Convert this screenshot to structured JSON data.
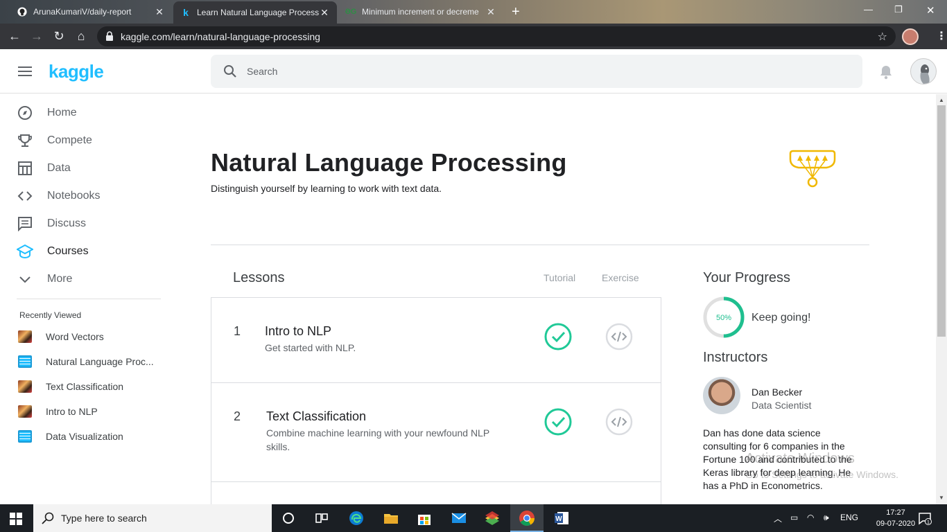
{
  "browser": {
    "tabs": [
      {
        "title": "ArunaKumariV/daily-report",
        "favicon": "github-icon"
      },
      {
        "title": "Learn Natural Language Processi",
        "favicon": "kaggle-icon"
      },
      {
        "title": "Minimum increment or decreme",
        "favicon": "gfg-icon"
      }
    ],
    "url": "kaggle.com/learn/natural-language-processing"
  },
  "header": {
    "logo": "kaggle",
    "search_placeholder": "Search"
  },
  "sidebar": {
    "items": [
      {
        "label": "Home",
        "icon": "compass-icon"
      },
      {
        "label": "Compete",
        "icon": "trophy-icon"
      },
      {
        "label": "Data",
        "icon": "table-icon"
      },
      {
        "label": "Notebooks",
        "icon": "code-icon"
      },
      {
        "label": "Discuss",
        "icon": "discuss-icon"
      },
      {
        "label": "Courses",
        "icon": "school-icon",
        "active": true
      },
      {
        "label": "More",
        "icon": "chevron-down-icon"
      }
    ],
    "recently_viewed_title": "Recently Viewed",
    "recently_viewed": [
      {
        "label": "Word Vectors",
        "icon": "course-thumbnail"
      },
      {
        "label": "Natural Language Proc...",
        "icon": "notebook-icon"
      },
      {
        "label": "Text Classification",
        "icon": "course-thumbnail"
      },
      {
        "label": "Intro to NLP",
        "icon": "course-thumbnail"
      },
      {
        "label": "Data Visualization",
        "icon": "notebook-icon"
      }
    ]
  },
  "course": {
    "title": "Natural Language Processing",
    "subtitle": "Distinguish yourself by learning to work with text data.",
    "lessons_heading": "Lessons",
    "col_tutorial": "Tutorial",
    "col_exercise": "Exercise",
    "lessons": [
      {
        "num": "1",
        "title": "Intro to NLP",
        "desc": "Get started with NLP.",
        "tutorial_done": true,
        "exercise_done": false
      },
      {
        "num": "2",
        "title": "Text Classification",
        "desc": "Combine machine learning with your newfound NLP skills.",
        "tutorial_done": true,
        "exercise_done": false
      }
    ]
  },
  "progress": {
    "heading": "Your Progress",
    "percent_label": "50%",
    "percent": 50,
    "message": "Keep going!"
  },
  "instructors": {
    "heading": "Instructors",
    "name": "Dan Becker",
    "role": "Data Scientist",
    "bio": "Dan has done data science consulting for 6 companies in the Fortune 100 and contributed to the Keras library for deep learning. He has a PhD in Econometrics."
  },
  "watermark": {
    "line1": "Activate Windows",
    "line2": "Go to Settings to activate Windows."
  },
  "taskbar": {
    "search_placeholder": "Type here to search",
    "language": "ENG",
    "time": "17:27",
    "date": "09-07-2020",
    "notifications": "1"
  },
  "colors": {
    "kaggle_blue": "#20beff",
    "success_green": "#20c997",
    "progress_green": "#1fbf8f",
    "course_gold": "#f0b800"
  }
}
